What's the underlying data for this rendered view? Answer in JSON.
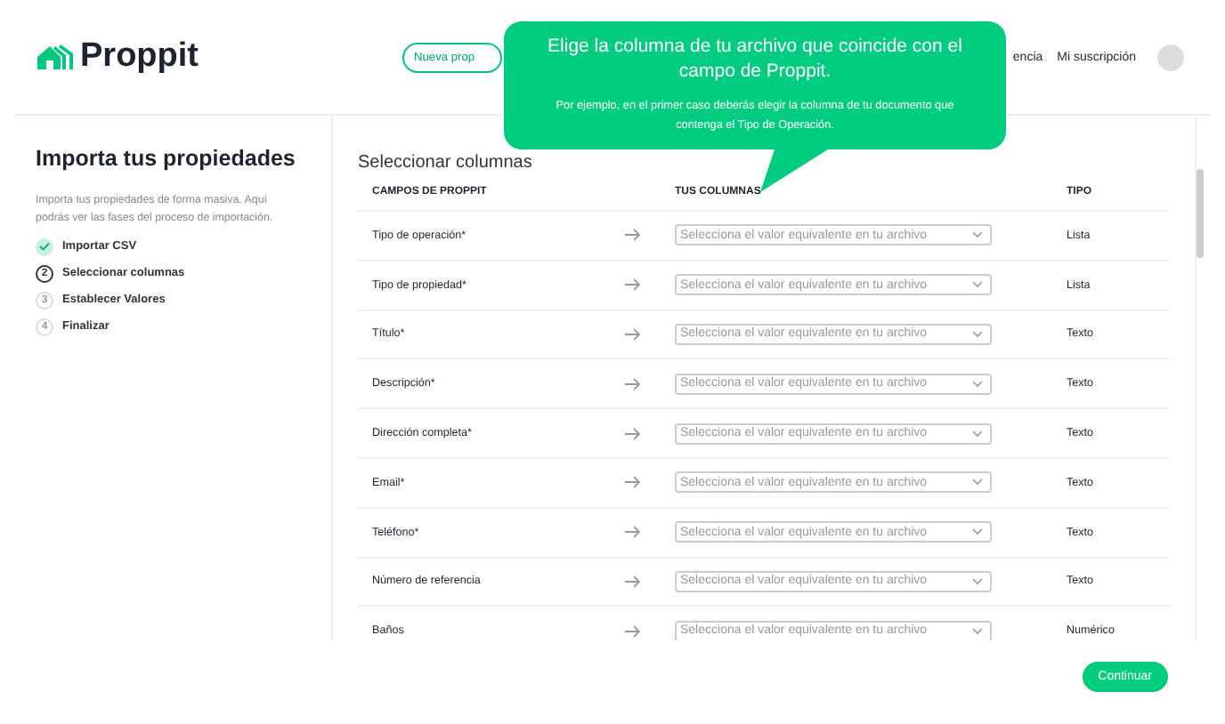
{
  "header": {
    "logo": "Proppit",
    "new_button": "Nueva prop",
    "nav_link": "encia",
    "subscription_link": "Mi suscripción"
  },
  "tooltip": {
    "title": "Elige la columna de tu archivo que coincide con el campo de Proppit.",
    "body": "Por ejemplo, en el primer caso deberás elegir la columna de tu documento que contenga el Tipo de Operación."
  },
  "sidebar": {
    "title": "Importa tus propiedades",
    "description": "Importa tus propiedades de forma masiva. Aquí podrás ver las fases del proceso de importación.",
    "steps": [
      {
        "kind": "done",
        "label": "Importar CSV"
      },
      {
        "kind": "current",
        "number": "2",
        "label": "Seleccionar columnas"
      },
      {
        "kind": "pending",
        "number": "3",
        "label": "Establecer Valores"
      },
      {
        "kind": "pending",
        "number": "4",
        "label": "Finalizar"
      }
    ]
  },
  "main": {
    "title": "Seleccionar columnas",
    "columns": [
      "CAMPOS DE PROPPIT",
      "TUS COLUMNAS",
      "TIPO"
    ],
    "rows": [
      {
        "field": "Tipo de operación*",
        "placeholder": "Selecciona el valor equivalente en tu archivo",
        "type": "Lista"
      },
      {
        "field": "Tipo de propiedad*",
        "placeholder": "Selecciona el valor equivalente en tu archivo",
        "type": "Lista"
      },
      {
        "field": "Título*",
        "placeholder": "Selecciona el valor equivalente en tu archivo",
        "type": "Texto"
      },
      {
        "field": "Descripción*",
        "placeholder": "Selecciona el valor equivalente en tu archivo",
        "type": "Texto"
      },
      {
        "field": "Dirección completa*",
        "placeholder": "Selecciona el valor equivalente en tu archivo",
        "type": "Texto"
      },
      {
        "field": "Email*",
        "placeholder": "Selecciona el valor equivalente en tu archivo",
        "type": "Texto"
      },
      {
        "field": "Teléfono*",
        "placeholder": "Selecciona el valor equivalente en tu archivo",
        "type": "Texto"
      },
      {
        "field": "Número de referencia",
        "placeholder": "Selecciona el valor equivalente en tu archivo",
        "type": "Texto"
      },
      {
        "field": "Baños",
        "placeholder": "Selecciona el valor equivalente en tu archivo",
        "type": "Numérico"
      }
    ]
  },
  "footer": {
    "continue_button": "Continuar"
  }
}
